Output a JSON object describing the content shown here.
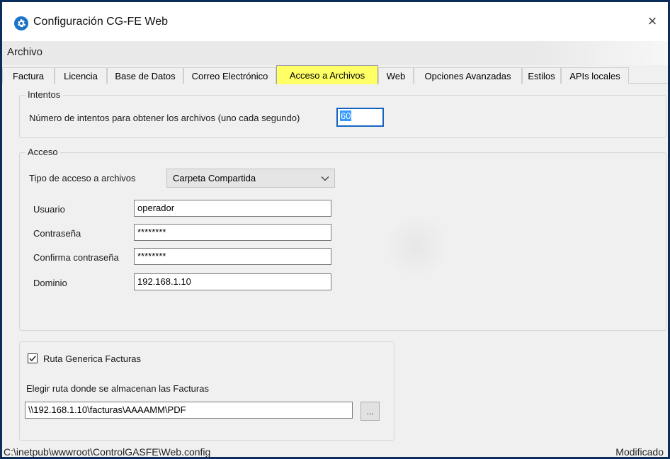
{
  "window": {
    "title": "Configuración CG-FE Web",
    "close_glyph": "×",
    "app_icon": "gear-icon",
    "close_icon": "close-icon"
  },
  "menu": {
    "archivo": "Archivo"
  },
  "tabs": [
    {
      "label": "Factura"
    },
    {
      "label": "Licencia"
    },
    {
      "label": "Base de Datos"
    },
    {
      "label": "Correo Electrónico"
    },
    {
      "label": "Acceso a Archivos",
      "active": true
    },
    {
      "label": "Web"
    },
    {
      "label": "Opciones Avanzadas"
    },
    {
      "label": "Estilos"
    },
    {
      "label": "APIs locales"
    }
  ],
  "intentos": {
    "legend": "Intentos",
    "label": "Número de intentos para obtener los archivos (uno cada segundo)",
    "value": "60"
  },
  "acceso": {
    "legend": "Acceso",
    "tipo_label": "Tipo de acceso a archivos",
    "tipo_value": "Carpeta Compartida",
    "usuario_label": "Usuario",
    "usuario_value": "operador",
    "contrasena_label": "Contraseña",
    "contrasena_value": "********",
    "confirma_label": "Confirma contraseña",
    "confirma_value": "********",
    "dominio_label": "Dominio",
    "dominio_value": "192.168.1.10"
  },
  "ruta": {
    "checkbox_label": "Ruta Generica Facturas",
    "checked": true,
    "elegir_label": "Elegir ruta donde se almacenan las Facturas",
    "path_value": "\\\\192.168.1.10\\facturas\\AAAAMM\\PDF",
    "browse_label": "..."
  },
  "status": {
    "path": "C:\\inetpub\\wwwroot\\ControlGASFE\\Web.config",
    "state": "Modificado"
  },
  "colors": {
    "active_tab": "#ffff66",
    "window_border": "#0b2d5b",
    "selection": "#3399ff",
    "icon_blue": "#1e73c8"
  }
}
